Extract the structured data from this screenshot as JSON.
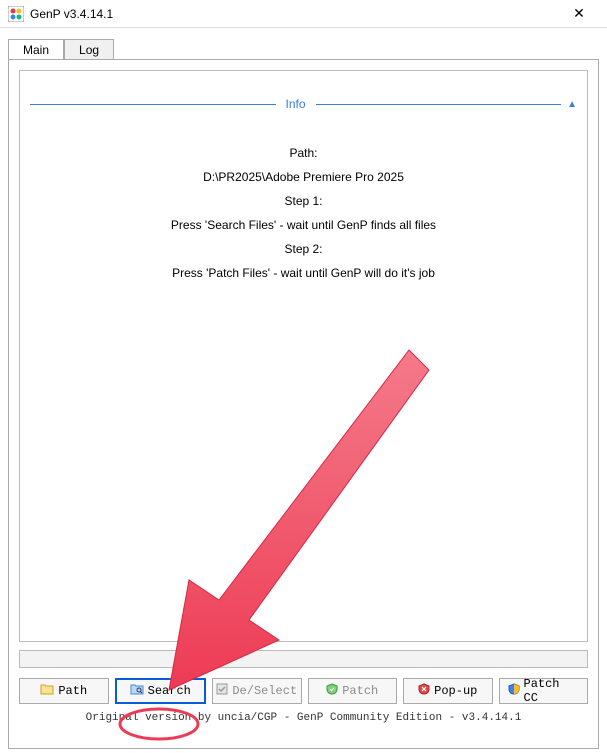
{
  "titlebar": {
    "title": "GenP v3.4.14.1"
  },
  "tabs": [
    {
      "label": "Main",
      "active": true
    },
    {
      "label": "Log",
      "active": false
    }
  ],
  "info": {
    "header": "Info",
    "lines": [
      "Path:",
      "D:\\PR2025\\Adobe Premiere Pro 2025",
      "Step 1:",
      "Press 'Search Files' - wait until GenP finds all files",
      "Step 2:",
      "Press 'Patch Files' - wait until GenP will do it's job"
    ]
  },
  "buttons": {
    "path": "Path",
    "search": "Search",
    "deselect": "De/Select",
    "patch": "Patch",
    "popup": "Pop-up",
    "patchcc": "Patch CC"
  },
  "footer": "Original version by uncia/CGP - GenP Community Edition - v3.4.14.1"
}
